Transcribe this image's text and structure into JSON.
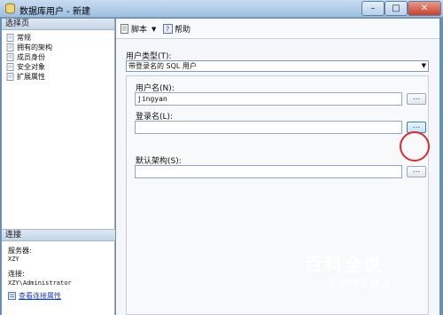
{
  "window": {
    "title": "数据库用户 - 新建",
    "minimize_label": "–",
    "maximize_label": "□",
    "close_label": "✕"
  },
  "left_pane": {
    "header": "选择页",
    "pages": [
      {
        "label": "常规",
        "icon": "page-icon"
      },
      {
        "label": "拥有的架构",
        "icon": "page-icon"
      },
      {
        "label": "成员身份",
        "icon": "page-icon"
      },
      {
        "label": "安全对象",
        "icon": "page-icon"
      },
      {
        "label": "扩展属性",
        "icon": "page-icon"
      }
    ],
    "connection": {
      "header": "连接",
      "server_label": "服务器:",
      "server_value": "XZY",
      "connection_label": "连接:",
      "connection_value": "XZY\\Administrator",
      "link_label": "查看连接属性"
    }
  },
  "toolbar": {
    "script_label": "脚本",
    "help_label": "帮助"
  },
  "form": {
    "user_type_label": "用户类型(T):",
    "user_type_value": "带登录名的 SQL 用户",
    "username_label": "用户名(N):",
    "username_value": "jingyan",
    "login_label": "登录名(L):",
    "login_value": "",
    "default_schema_label": "默认架构(S):",
    "default_schema_value": "",
    "browse_label": "..."
  },
  "watermark": {
    "main": "百科全说",
    "sub": "助你轻松解决"
  },
  "colors": {
    "highlight_ring": "#e02a2a",
    "accent": "#3c7fb1"
  }
}
